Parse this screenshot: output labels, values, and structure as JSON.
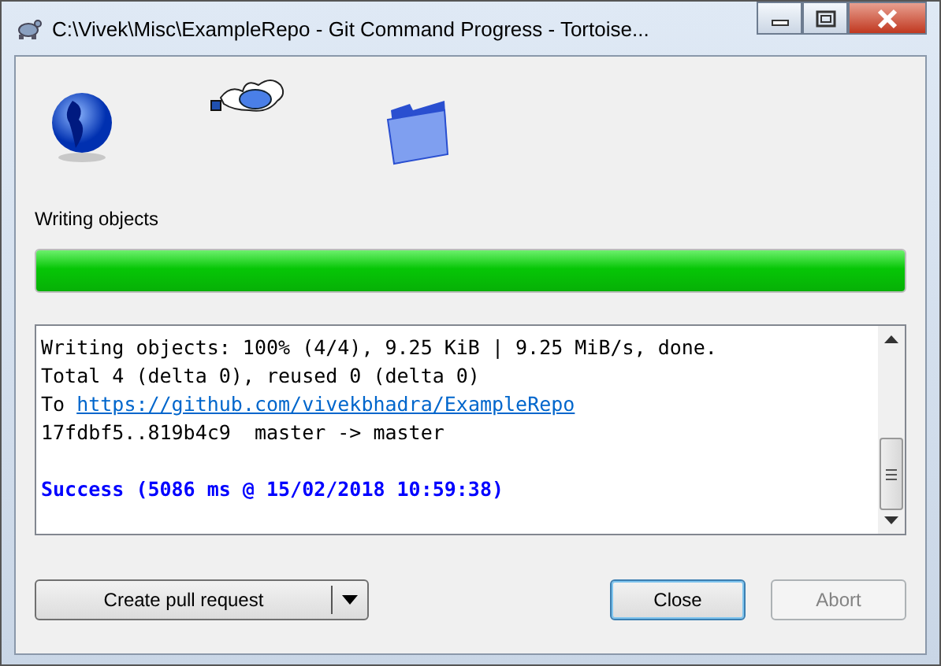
{
  "window": {
    "title": "C:\\Vivek\\Misc\\ExampleRepo - Git Command Progress - Tortoise..."
  },
  "status": {
    "text": "Writing objects"
  },
  "progress": {
    "level": 1
  },
  "log": [
    {
      "kind": "text",
      "text": "Writing objects: 100% (4/4), 9.25 KiB | 9.25 MiB/s, done."
    },
    {
      "kind": "text",
      "text": "Total 4 (delta 0), reused 0 (delta 0)"
    },
    {
      "kind": "link",
      "prefix": "To",
      "url": "https://github.com/vivekbhadra/ExampleRepo"
    },
    {
      "kind": "text",
      "text": "17fdbf5..819b4c9  master -> master"
    },
    {
      "kind": "success",
      "text": "Success (5086 ms @ 15/02/2018 10:59:38)"
    }
  ],
  "buttons": [
    {
      "label": "Create pull request",
      "kind": "split",
      "default": false,
      "disabled": false
    },
    {
      "label": "Close",
      "kind": "plain",
      "default": true,
      "disabled": false
    },
    {
      "label": "Abort",
      "kind": "plain",
      "default": false,
      "disabled": true
    }
  ]
}
